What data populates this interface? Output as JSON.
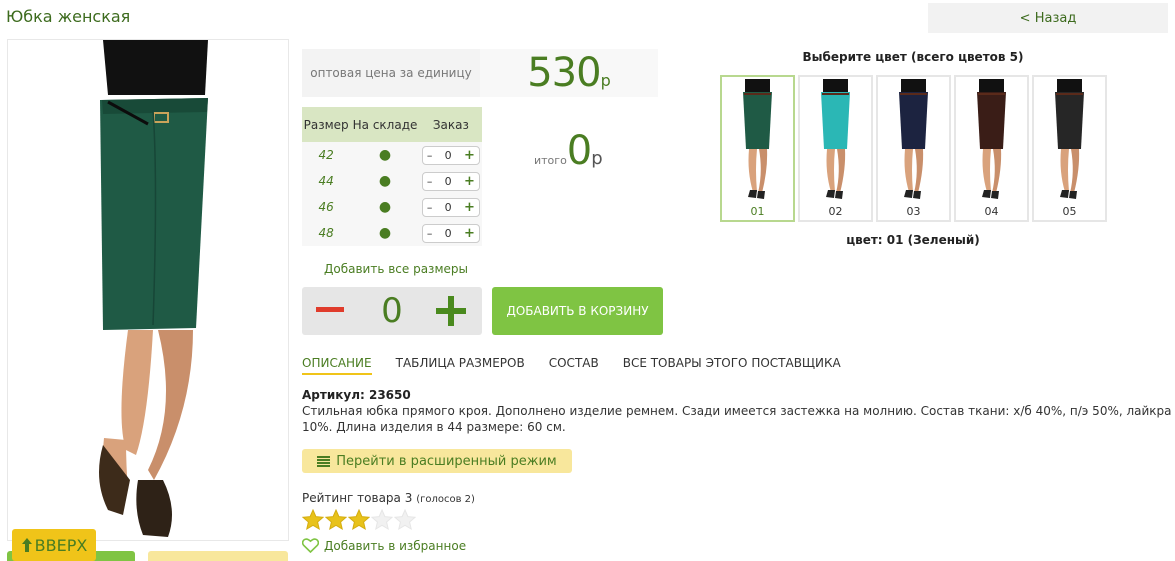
{
  "header": {
    "title": "Юбка женская",
    "back_label": "< Назад"
  },
  "price": {
    "label": "оптовая цена за единицу",
    "value": "530",
    "currency": "р"
  },
  "size_table": {
    "headers": [
      "Размер",
      "На складе",
      "Заказ"
    ],
    "rows": [
      {
        "size": "42",
        "in_stock": "●",
        "qty": "0"
      },
      {
        "size": "44",
        "in_stock": "●",
        "qty": "0"
      },
      {
        "size": "46",
        "in_stock": "●",
        "qty": "0"
      },
      {
        "size": "48",
        "in_stock": "●",
        "qty": "0"
      }
    ],
    "minus_symbol": "–",
    "plus_symbol": "+"
  },
  "total": {
    "label": "итого",
    "value": "0",
    "currency": "р"
  },
  "add_all_sizes": "Добавить все размеры",
  "quantity": {
    "value": "0"
  },
  "cart_button": "ДОБАВИТЬ В КОРЗИНУ",
  "tabs": [
    {
      "label": "ОПИСАНИЕ",
      "active": true
    },
    {
      "label": "ТАБЛИЦА РАЗМЕРОВ",
      "active": false
    },
    {
      "label": "СОСТАВ",
      "active": false
    },
    {
      "label": "ВСЕ ТОВАРЫ ЭТОГО ПОСТАВЩИКА",
      "active": false
    }
  ],
  "description": {
    "article": "Артикул: 23650",
    "text": "Стильная юбка прямого кроя. Дополнено изделие ремнем. Сзади имеется застежка на молнию. Состав ткани: х/б 40%, п/э 50%, лайкра 10%. Длина изделия в 44 размере: 60 см."
  },
  "extended_mode": {
    "label": "Перейти в расширенный режим",
    "icon": "list-icon"
  },
  "rating": {
    "label": "Рейтинг товара 3",
    "votes": "(голосов 2)",
    "value": 3,
    "max": 5
  },
  "favorite": {
    "label": "Добавить в избранное",
    "icon": "heart-icon"
  },
  "colors": {
    "title": "Выберите цвет (всего цветов 5)",
    "selected_label": "цвет: 01 (Зеленый)",
    "swatches": [
      {
        "num": "01",
        "color": "#1f5a45",
        "active": true
      },
      {
        "num": "02",
        "color": "#2bb7b5",
        "active": false
      },
      {
        "num": "03",
        "color": "#1c2340",
        "active": false
      },
      {
        "num": "04",
        "color": "#3a1d17",
        "active": false
      },
      {
        "num": "05",
        "color": "#262626",
        "active": false
      }
    ]
  },
  "footer": {
    "up_label": "ВВЕРХ",
    "up_icon": "arrow-up-icon"
  },
  "theme": {
    "accent_green": "#4a7d22",
    "button_green": "#7fc443",
    "yellow": "#f8e79c",
    "skirt_color": "#1f5a45"
  }
}
